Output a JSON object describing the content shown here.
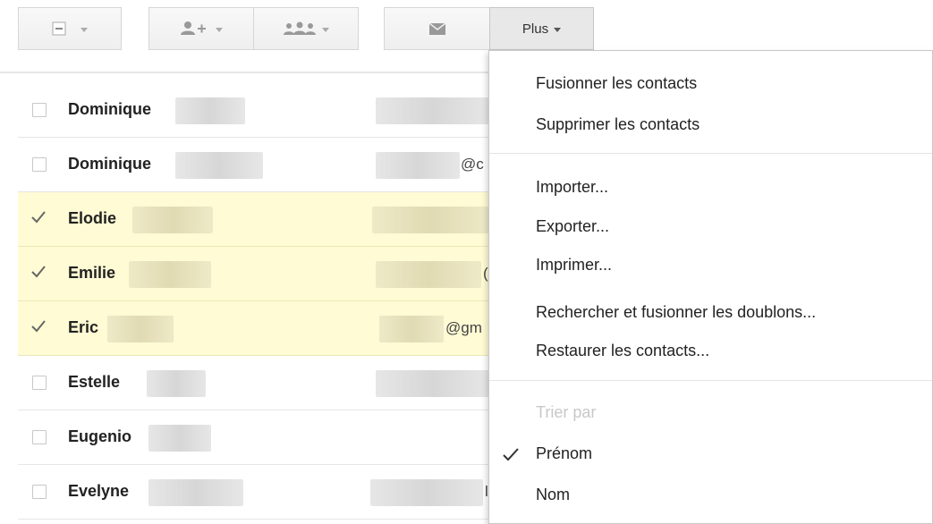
{
  "toolbar": {
    "plus_label": "Plus"
  },
  "contacts": [
    {
      "name": "Dominique",
      "email_fragment": "",
      "selected": false
    },
    {
      "name": "Dominique",
      "email_fragment": "@c",
      "selected": false
    },
    {
      "name": "Elodie",
      "email_fragment": "",
      "selected": true
    },
    {
      "name": "Emilie",
      "email_fragment": "(",
      "selected": true
    },
    {
      "name": "Eric",
      "email_fragment": "@gm",
      "selected": true
    },
    {
      "name": "Estelle",
      "email_fragment": "",
      "selected": false
    },
    {
      "name": "Eugenio",
      "email_fragment": "",
      "selected": false
    },
    {
      "name": "Evelyne",
      "email_fragment": "l",
      "selected": false
    }
  ],
  "menu": {
    "merge": "Fusionner les contacts",
    "delete": "Supprimer les contacts",
    "import": "Importer...",
    "export": "Exporter...",
    "print": "Imprimer...",
    "find_duplicates": "Rechercher et fusionner les doublons...",
    "restore": "Restaurer les contacts...",
    "sort_by": "Trier par",
    "sort_firstname": "Prénom",
    "sort_lastname": "Nom",
    "sort_selected": "Prénom"
  },
  "colors": {
    "selected_row": "#fffbd4",
    "disabled_text": "#c8c8c8"
  }
}
